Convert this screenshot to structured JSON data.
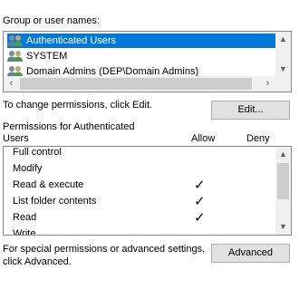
{
  "groups": {
    "label": "Group or user names:",
    "items": [
      {
        "name": "Authenticated Users",
        "selected": true,
        "icon": "user-group-icon"
      },
      {
        "name": "SYSTEM",
        "selected": false,
        "icon": "user-group-icon"
      },
      {
        "name": "Domain Admins (DEP\\Domain Admins)",
        "selected": false,
        "icon": "user-group-icon"
      }
    ]
  },
  "edit": {
    "text": "To change permissions, click Edit.",
    "button_label": "Edit..."
  },
  "permissions": {
    "label_line1": "Permissions for Authenticated",
    "label_line2": "Users",
    "allow_header": "Allow",
    "deny_header": "Deny",
    "items": [
      {
        "name": "Full control",
        "allow": false,
        "deny": false
      },
      {
        "name": "Modify",
        "allow": false,
        "deny": false
      },
      {
        "name": "Read & execute",
        "allow": true,
        "deny": false
      },
      {
        "name": "List folder contents",
        "allow": true,
        "deny": false
      },
      {
        "name": "Read",
        "allow": true,
        "deny": false
      },
      {
        "name": "Write",
        "allow": false,
        "deny": false
      }
    ],
    "check_glyph": "✓"
  },
  "advanced": {
    "text_line1": "For special permissions or advanced settings,",
    "text_line2": "click Advanced.",
    "button_label": "Advanced"
  },
  "colors": {
    "selection": "#0078d7",
    "button_bg": "#e1e1e1",
    "scrollbar_bg": "#f0f0f0"
  }
}
